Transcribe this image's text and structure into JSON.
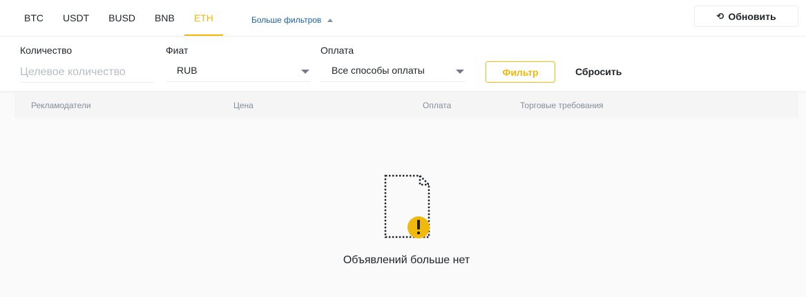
{
  "tabs": [
    {
      "label": "BTC",
      "active": false
    },
    {
      "label": "USDT",
      "active": false
    },
    {
      "label": "BUSD",
      "active": false
    },
    {
      "label": "BNB",
      "active": false
    },
    {
      "label": "ETH",
      "active": true
    }
  ],
  "more_filters_label": "Больше фильтров",
  "refresh_label": "Обновить",
  "filters": {
    "amount_label": "Количество",
    "amount_placeholder": "Целевое количество",
    "fiat_label": "Фиат",
    "fiat_value": "RUB",
    "payment_label": "Оплата",
    "payment_value": "Все способы оплаты",
    "filter_button": "Фильтр",
    "reset_button": "Сбросить"
  },
  "table_headers": [
    "Рекламодатели",
    "Цена",
    "Оплата",
    "Торговые требования"
  ],
  "empty_state_text": "Объявлений больше нет",
  "icons": {
    "refresh": "refresh-icon",
    "more_filters": "caret-up-icon",
    "dropdown": "chevron-down-icon",
    "empty": "empty-document-warning-icon"
  },
  "colors": {
    "accent": "#f0b90b",
    "link": "#1a5fa8",
    "text": "#1e2329",
    "muted": "#848e9c"
  }
}
